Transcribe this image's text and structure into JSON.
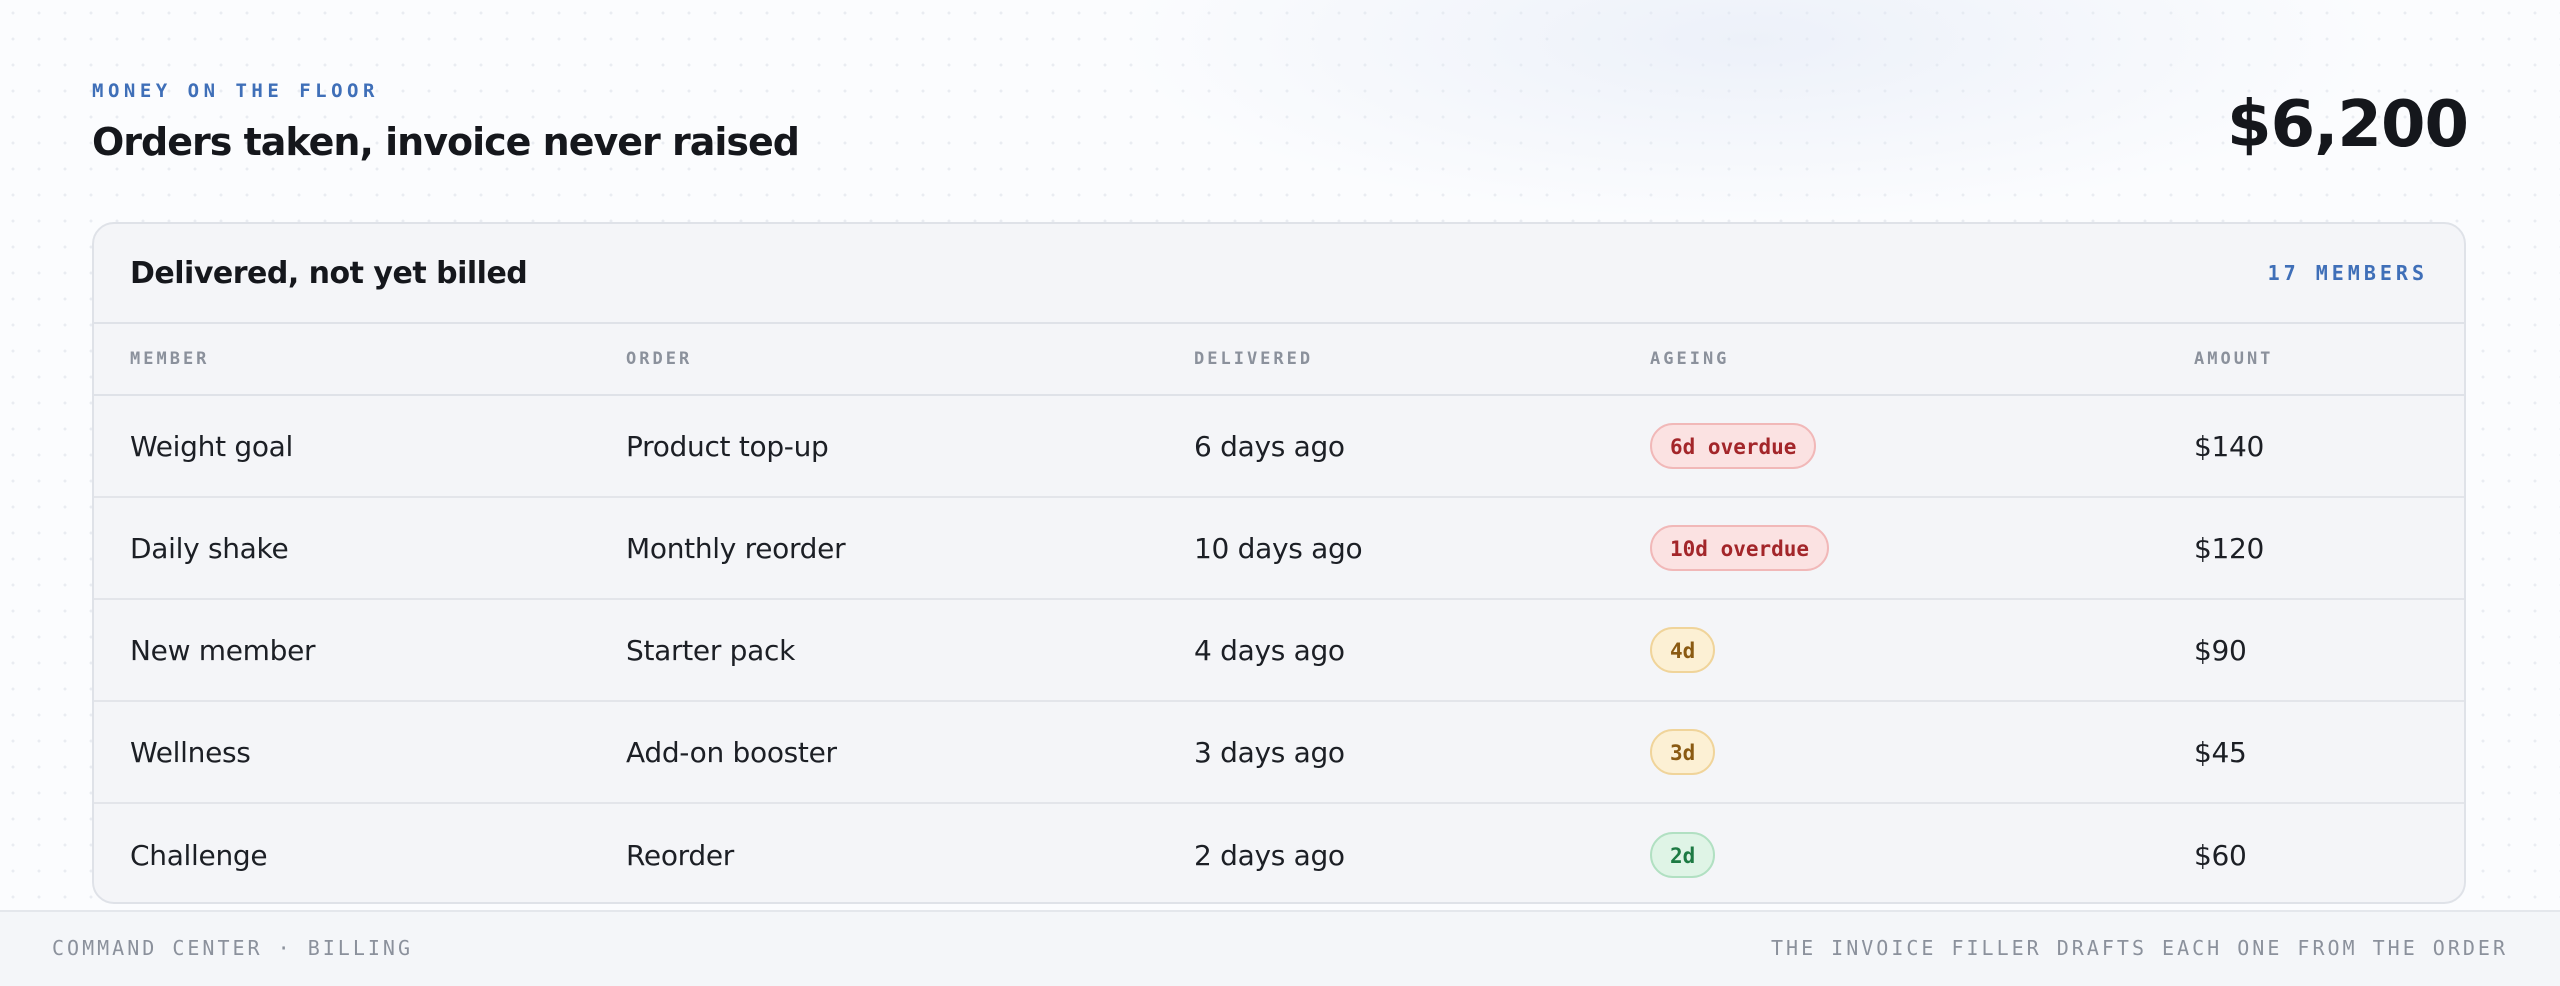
{
  "header": {
    "eyebrow": "MONEY ON THE FLOOR",
    "title": "Orders taken, invoice never raised",
    "total": "$6,200"
  },
  "card": {
    "title": "Delivered, not yet billed",
    "members_count": "17 MEMBERS"
  },
  "table": {
    "columns": [
      "MEMBER",
      "ORDER",
      "DELIVERED",
      "AGEING",
      "AMOUNT"
    ],
    "rows": [
      {
        "member": "Weight goal",
        "order": "Product top-up",
        "delivered": "6 days ago",
        "ageing": "6d overdue",
        "ageing_status": "overdue",
        "amount": "$140"
      },
      {
        "member": "Daily shake",
        "order": "Monthly reorder",
        "delivered": "10 days ago",
        "ageing": "10d overdue",
        "ageing_status": "overdue",
        "amount": "$120"
      },
      {
        "member": "New member",
        "order": "Starter pack",
        "delivered": "4 days ago",
        "ageing": "4d",
        "ageing_status": "warning",
        "amount": "$90"
      },
      {
        "member": "Wellness",
        "order": "Add-on booster",
        "delivered": "3 days ago",
        "ageing": "3d",
        "ageing_status": "warning",
        "amount": "$45"
      },
      {
        "member": "Challenge",
        "order": "Reorder",
        "delivered": "2 days ago",
        "ageing": "2d",
        "ageing_status": "ok",
        "amount": "$60"
      }
    ]
  },
  "footer": {
    "left": "COMMAND CENTER · BILLING",
    "right": "THE INVOICE FILLER DRAFTS EACH ONE FROM THE ORDER"
  },
  "colors": {
    "accent": "#3f6fb8",
    "overdue": "#a3262a",
    "warning": "#8a5a12",
    "ok": "#1d7a43"
  }
}
